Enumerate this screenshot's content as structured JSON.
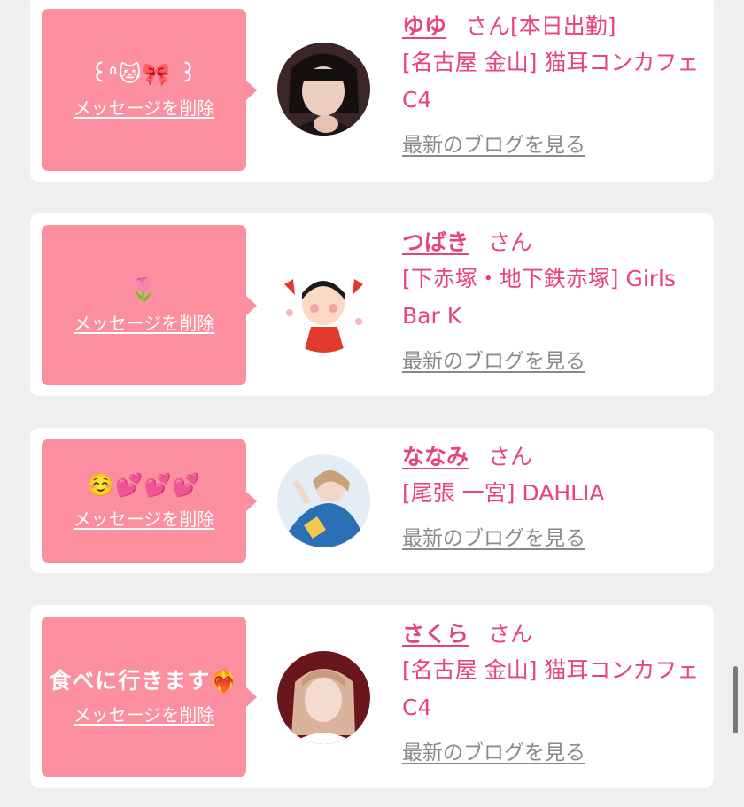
{
  "entries": [
    {
      "message": "꒰ᐢ🐱🎀 ꒱",
      "delete_label": "メッセージを削除",
      "name": "ゆゆ",
      "honorific": "さん",
      "status": "[本日出勤]",
      "shop": "[名古屋 金山] 猫耳コンカフェ C4",
      "blog_label": "最新のブログを見る",
      "avatar_colors": [
        "#2a1e1e",
        "#e9c6b8"
      ]
    },
    {
      "message": "🌷",
      "delete_label": "メッセージを削除",
      "name": "つばき",
      "honorific": "さん",
      "status": "",
      "shop": "[下赤塚・地下鉄赤塚] Girls Bar K",
      "blog_label": "最新のブログを見る",
      "avatar_colors": [
        "#ffffff",
        "#e23b2e"
      ]
    },
    {
      "message": "☺️💕💕💕",
      "delete_label": "メッセージを削除",
      "name": "ななみ",
      "honorific": "さん",
      "status": "",
      "shop": "[尾張 一宮] DAHLIA",
      "blog_label": "最新のブログを見る",
      "avatar_colors": [
        "#dfe9f3",
        "#2b6fb4"
      ]
    },
    {
      "message": "食べに行きます❤️‍🔥",
      "delete_label": "メッセージを削除",
      "name": "さくら",
      "honorific": "さん",
      "status": "",
      "shop": "[名古屋 金山] 猫耳コンカフェ C4",
      "blog_label": "最新のブログを見る",
      "avatar_colors": [
        "#7a1b22",
        "#d9a08a"
      ]
    }
  ],
  "colors": {
    "accent": "#e8437a",
    "bubble": "#fb8f9f",
    "background": "#efefef",
    "link_gray": "#8a8a8a"
  }
}
